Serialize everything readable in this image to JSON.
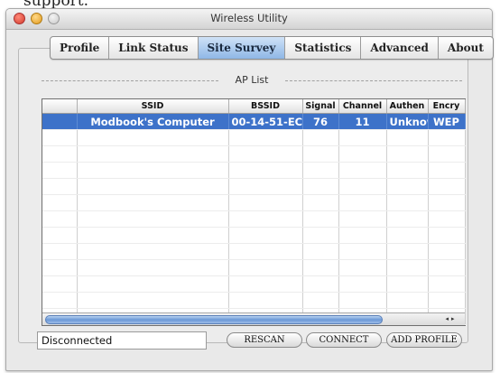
{
  "caption": "support.",
  "window": {
    "title": "Wireless Utility"
  },
  "tabs": [
    "Profile",
    "Link Status",
    "Site Survey",
    "Statistics",
    "Advanced",
    "About"
  ],
  "active_tab": "Site Survey",
  "ap_list": {
    "label": "AP List",
    "columns": [
      "",
      "SSID",
      "BSSID",
      "Signal",
      "Channel",
      "Authen",
      "Encry"
    ],
    "rows": [
      {
        "selected": true,
        "cells": [
          "",
          "Modbook's Computer",
          "00-14-51-EC",
          "76",
          "11",
          "Unknown",
          "WEP"
        ]
      }
    ],
    "empty_rows": 12
  },
  "status": "Disconnected",
  "buttons": {
    "rescan": "RESCAN",
    "connect": "CONNECT",
    "add_profile": "ADD PROFILE"
  }
}
